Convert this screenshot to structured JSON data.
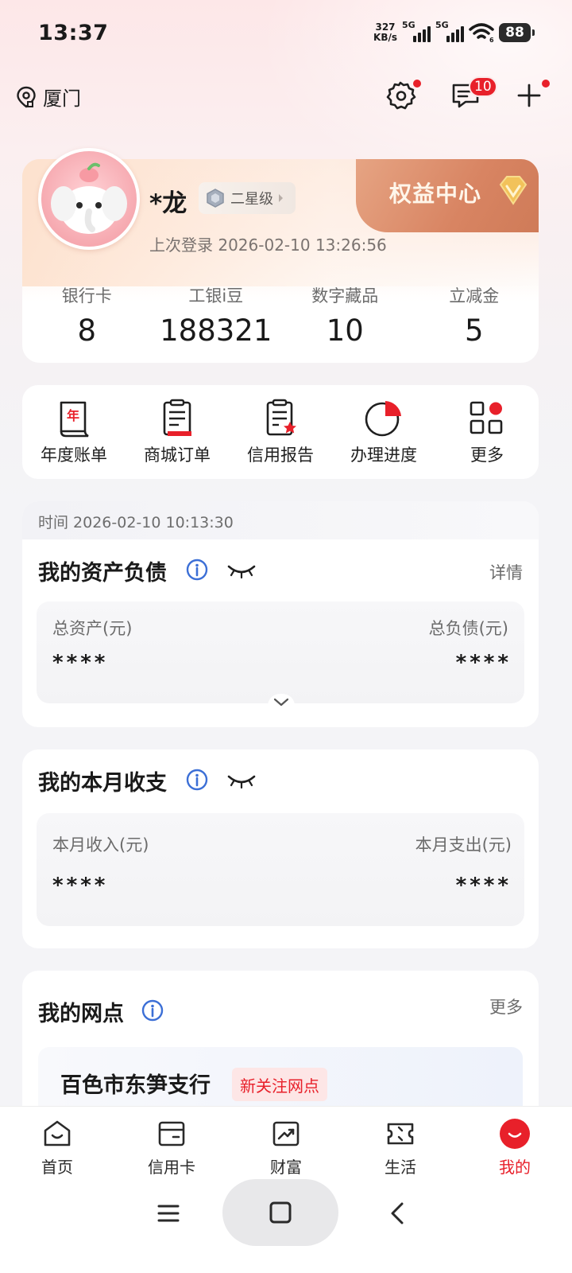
{
  "status_bar": {
    "time": "13:37",
    "net_speed_value": "327",
    "net_speed_unit": "KB/s",
    "sim1_tag": "5G",
    "sim2_tag": "5G",
    "wifi_tag": "6",
    "battery": "88"
  },
  "header": {
    "location": "厦门",
    "messages_count": "10"
  },
  "profile": {
    "name": "*龙",
    "level": "二星级",
    "last_login": "上次登录 2026-02-10 13:26:56",
    "rights_center": "权益中心",
    "stats": [
      {
        "label": "银行卡",
        "value": "8"
      },
      {
        "label": "工银i豆",
        "value": "188321"
      },
      {
        "label": "数字藏品",
        "value": "10"
      },
      {
        "label": "立减金",
        "value": "5"
      }
    ]
  },
  "quick_actions": [
    {
      "label": "年度账单",
      "icon": "annual-bill-icon"
    },
    {
      "label": "商城订单",
      "icon": "mall-order-icon"
    },
    {
      "label": "信用报告",
      "icon": "credit-report-icon"
    },
    {
      "label": "办理进度",
      "icon": "progress-icon"
    },
    {
      "label": "更多",
      "icon": "more-grid-icon"
    }
  ],
  "assets": {
    "timestamp": "时间 2026-02-10 10:13:30",
    "title": "我的资产负债",
    "detail": "详情",
    "total_assets_label": "总资产(元)",
    "total_assets_value": "****",
    "total_debt_label": "总负债(元)",
    "total_debt_value": "****"
  },
  "monthly": {
    "title": "我的本月收支",
    "income_label": "本月收入(元)",
    "income_value": "****",
    "expense_label": "本月支出(元)",
    "expense_value": "****"
  },
  "branch": {
    "title": "我的网点",
    "more": "更多",
    "name": "百色市东笋支行",
    "tag": "新关注网点"
  },
  "bottom_nav": [
    {
      "label": "首页"
    },
    {
      "label": "信用卡"
    },
    {
      "label": "财富"
    },
    {
      "label": "生活"
    },
    {
      "label": "我的"
    }
  ],
  "colors": {
    "accent": "#e8202a",
    "rights_banner": "#d88462"
  }
}
